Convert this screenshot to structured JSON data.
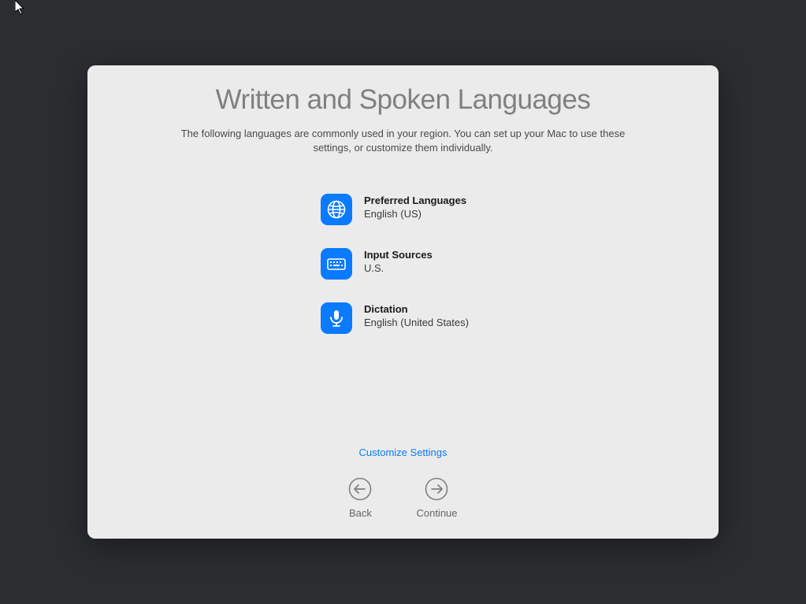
{
  "title": "Written and Spoken Languages",
  "subtitle": "The following languages are commonly used in your region. You can set up your Mac to use these settings, or customize them individually.",
  "settings": {
    "preferred_languages": {
      "label": "Preferred Languages",
      "value": "English (US)"
    },
    "input_sources": {
      "label": "Input Sources",
      "value": "U.S."
    },
    "dictation": {
      "label": "Dictation",
      "value": "English (United States)"
    }
  },
  "customize_label": "Customize Settings",
  "nav": {
    "back": "Back",
    "continue": "Continue"
  },
  "colors": {
    "accent": "#0a7aff",
    "panel_bg": "#ebebeb",
    "desktop_bg": "#2c2d31"
  }
}
